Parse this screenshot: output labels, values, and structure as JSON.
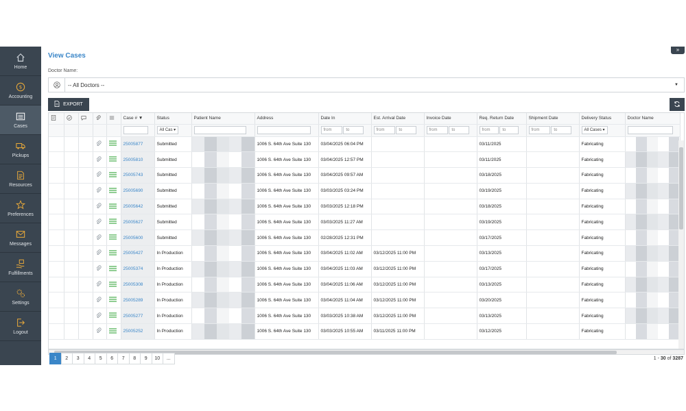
{
  "sidebar": {
    "items": [
      {
        "label": "Home",
        "icon": "home-icon"
      },
      {
        "label": "Accounting",
        "icon": "dollar-icon"
      },
      {
        "label": "Cases",
        "icon": "list-icon",
        "active": true
      },
      {
        "label": "Pickups",
        "icon": "truck-icon"
      },
      {
        "label": "Resources",
        "icon": "file-icon"
      },
      {
        "label": "Preferences",
        "icon": "star-icon"
      },
      {
        "label": "Messages",
        "icon": "envelope-icon"
      },
      {
        "label": "Fulfillments",
        "icon": "box-hand-icon"
      },
      {
        "label": "Settings",
        "icon": "gears-icon"
      },
      {
        "label": "Logout",
        "icon": "logout-icon"
      }
    ]
  },
  "page": {
    "title": "View Cases",
    "doctor_label": "Doctor Name:",
    "doctor_value": "-- All Doctors --",
    "export_label": "EXPORT"
  },
  "table": {
    "headers": {
      "case": "Case #",
      "status": "Status",
      "patient": "Patient Name",
      "address": "Address",
      "date_in": "Date In",
      "est_arrival": "Est. Arrival Date",
      "invoice": "Invoice Date",
      "req_return": "Req. Return Date",
      "shipment": "Shipment Date",
      "delivery": "Delivery Status",
      "doctor": "Doctor Name"
    },
    "filters": {
      "status": "All Cas",
      "delivery": "All Cases",
      "from": "from",
      "to": "to"
    },
    "rows": [
      {
        "case": "25005877",
        "status": "Submitted",
        "address": "1006 S. 64th Ave Suite 130",
        "date_in": "03/04/2025 06:04 PM",
        "est": "",
        "req": "03/11/2025",
        "delivery": "Fabricating"
      },
      {
        "case": "25005810",
        "status": "Submitted",
        "address": "1006 S. 64th Ave Suite 130",
        "date_in": "03/04/2025 12:57 PM",
        "est": "",
        "req": "03/11/2025",
        "delivery": "Fabricating"
      },
      {
        "case": "25005743",
        "status": "Submitted",
        "address": "1006 S. 64th Ave Suite 130",
        "date_in": "03/04/2025 09:57 AM",
        "est": "",
        "req": "03/18/2025",
        "delivery": "Fabricating"
      },
      {
        "case": "25005690",
        "status": "Submitted",
        "address": "1006 S. 64th Ave Suite 130",
        "date_in": "03/03/2025 03:24 PM",
        "est": "",
        "req": "03/19/2025",
        "delivery": "Fabricating"
      },
      {
        "case": "25005642",
        "status": "Submitted",
        "address": "1006 S. 64th Ave Suite 130",
        "date_in": "03/03/2025 12:18 PM",
        "est": "",
        "req": "03/18/2025",
        "delivery": "Fabricating"
      },
      {
        "case": "25005627",
        "status": "Submitted",
        "address": "1006 S. 64th Ave Suite 130",
        "date_in": "03/03/2025 11:27 AM",
        "est": "",
        "req": "03/19/2025",
        "delivery": "Fabricating"
      },
      {
        "case": "25005600",
        "status": "Submitted",
        "address": "1006 S. 64th Ave Suite 130",
        "date_in": "02/28/2025 12:31 PM",
        "est": "",
        "req": "03/17/2025",
        "delivery": "Fabricating"
      },
      {
        "case": "25005427",
        "status": "In Production",
        "address": "1006 S. 64th Ave Suite 130",
        "date_in": "03/04/2025 11:02 AM",
        "est": "03/12/2025 11:00 PM",
        "req": "03/13/2025",
        "delivery": "Fabricating"
      },
      {
        "case": "25005374",
        "status": "In Production",
        "address": "1006 S. 64th Ave Suite 130",
        "date_in": "03/04/2025 11:03 AM",
        "est": "03/12/2025 11:00 PM",
        "req": "03/17/2025",
        "delivery": "Fabricating"
      },
      {
        "case": "25005308",
        "status": "In Production",
        "address": "1006 S. 64th Ave Suite 130",
        "date_in": "03/04/2025 11:06 AM",
        "est": "03/12/2025 11:00 PM",
        "req": "03/13/2025",
        "delivery": "Fabricating"
      },
      {
        "case": "25005289",
        "status": "In Production",
        "address": "1006 S. 64th Ave Suite 130",
        "date_in": "03/04/2025 11:04 AM",
        "est": "03/12/2025 11:00 PM",
        "req": "03/20/2025",
        "delivery": "Fabricating"
      },
      {
        "case": "25005277",
        "status": "In Production",
        "address": "1006 S. 64th Ave Suite 130",
        "date_in": "03/03/2025 10:38 AM",
        "est": "03/12/2025 11:00 PM",
        "req": "03/13/2025",
        "delivery": "Fabricating"
      },
      {
        "case": "25005252",
        "status": "In Production",
        "address": "1006 S. 64th Ave Suite 130",
        "date_in": "03/03/2025 10:55 AM",
        "est": "03/11/2025 11:00 PM",
        "req": "03/12/2025",
        "delivery": "Fabricating"
      }
    ]
  },
  "pager": {
    "pages": [
      "1",
      "2",
      "3",
      "4",
      "5",
      "6",
      "7",
      "8",
      "9",
      "10",
      "..."
    ],
    "range_start": "1",
    "range_end": "30",
    "of_label": "of",
    "total": "3287"
  },
  "colors": {
    "sidebar_bg": "#3a4550",
    "accent": "#3a86c8",
    "menu_icon": "#4caf50"
  }
}
